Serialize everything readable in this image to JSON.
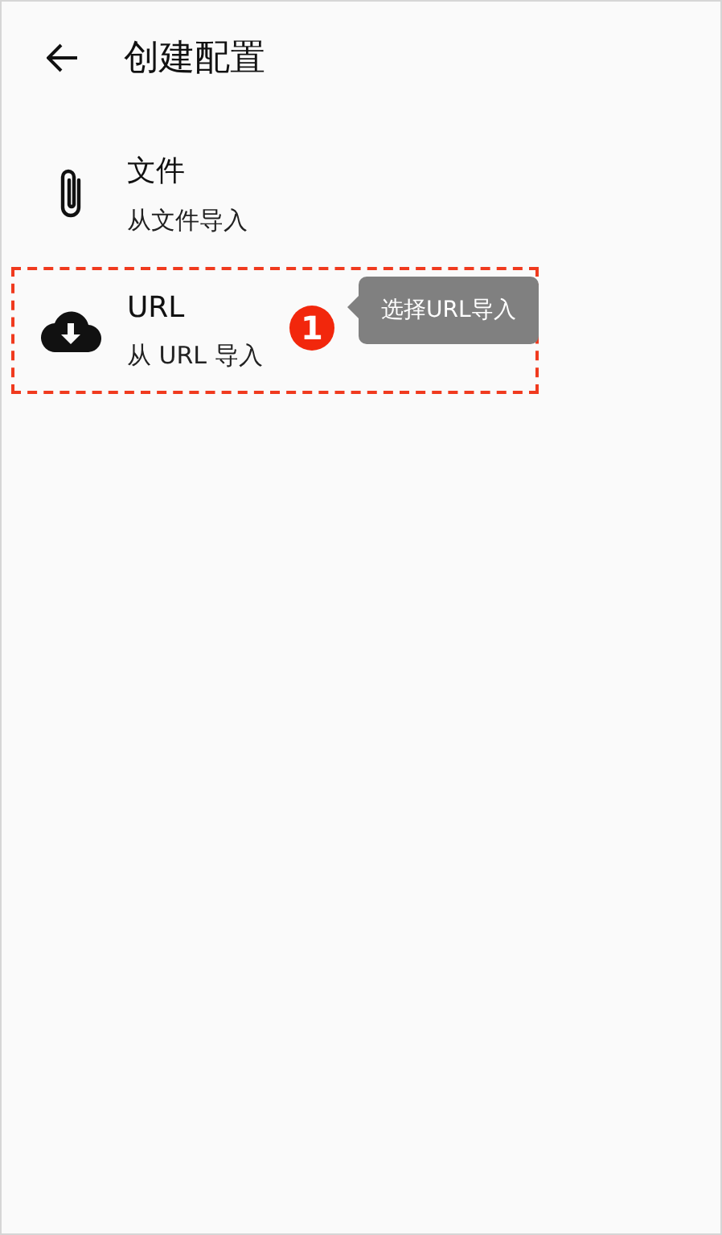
{
  "header": {
    "title": "创建配置"
  },
  "items": [
    {
      "kind": "file",
      "title": "文件",
      "subtitle": "从文件导入",
      "highlighted": false
    },
    {
      "kind": "url",
      "title": "URL",
      "subtitle": "从 URL 导入",
      "highlighted": true,
      "badge": "1",
      "tooltip": "选择URL导入"
    }
  ]
}
